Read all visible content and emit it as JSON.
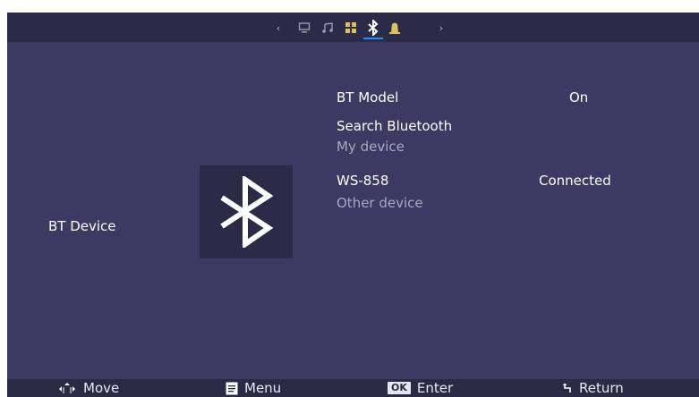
{
  "tabs": {
    "items": [
      {
        "id": "picture",
        "icon": "monitor-icon"
      },
      {
        "id": "sound",
        "icon": "music-note-icon"
      },
      {
        "id": "apps",
        "icon": "grid-icon"
      },
      {
        "id": "bluetooth",
        "icon": "bluetooth-icon",
        "active": true
      },
      {
        "id": "notifications",
        "icon": "bell-icon"
      }
    ],
    "left_arrow": "‹",
    "right_arrow": "›"
  },
  "page": {
    "title": "BT Device"
  },
  "settings": {
    "bt_model_label": "BT Model",
    "bt_model_value": "On",
    "search_label": "Search Bluetooth",
    "my_device_header": "My device",
    "device_name": "WS-858",
    "device_status": "Connected",
    "other_device_header": "Other device"
  },
  "footer": {
    "move_label": "Move",
    "menu_label": "Menu",
    "ok_badge": "OK",
    "enter_label": "Enter",
    "return_label": "Return"
  },
  "colors": {
    "panel": "#3c3a62",
    "bar": "#2c2b47",
    "accent": "#2a8df7",
    "muted_text": "#a9a8c3"
  }
}
